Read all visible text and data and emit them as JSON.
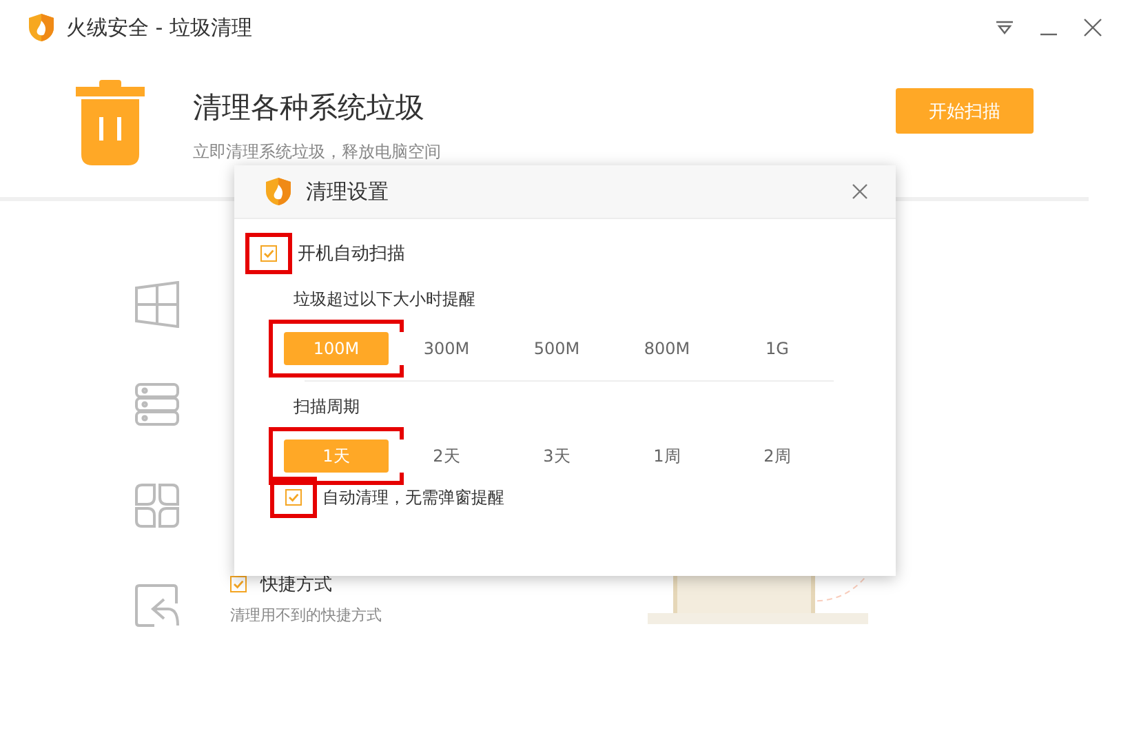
{
  "window": {
    "title": "火绒安全 - 垃圾清理"
  },
  "header": {
    "title": "清理各种系统垃圾",
    "subtitle": "立即清理系统垃圾，释放电脑空间",
    "button": "开始扫描"
  },
  "categories": [
    {
      "kind": "windows"
    },
    {
      "kind": "server"
    },
    {
      "kind": "grid"
    },
    {
      "kind": "shortcut",
      "checked": true,
      "title": "快捷方式",
      "description": "清理用不到的快捷方式"
    }
  ],
  "dialog": {
    "title": "清理设置",
    "auto_scan": {
      "label": "开机自动扫描",
      "checked": true,
      "highlighted": true
    },
    "size_label": "垃圾超过以下大小时提醒",
    "sizes": [
      {
        "label": "100M",
        "selected": true,
        "highlighted": true
      },
      {
        "label": "300M",
        "selected": false,
        "highlighted": false
      },
      {
        "label": "500M",
        "selected": false,
        "highlighted": false
      },
      {
        "label": "800M",
        "selected": false,
        "highlighted": false
      },
      {
        "label": "1G",
        "selected": false,
        "highlighted": false
      }
    ],
    "period_label": "扫描周期",
    "periods": [
      {
        "label": "1天",
        "selected": true,
        "highlighted": true
      },
      {
        "label": "2天",
        "selected": false,
        "highlighted": false
      },
      {
        "label": "3天",
        "selected": false,
        "highlighted": false
      },
      {
        "label": "1周",
        "selected": false,
        "highlighted": false
      },
      {
        "label": "2周",
        "selected": false,
        "highlighted": false
      }
    ],
    "auto_clean": {
      "label": "自动清理，无需弹窗提醒",
      "checked": true,
      "highlighted": true
    }
  }
}
